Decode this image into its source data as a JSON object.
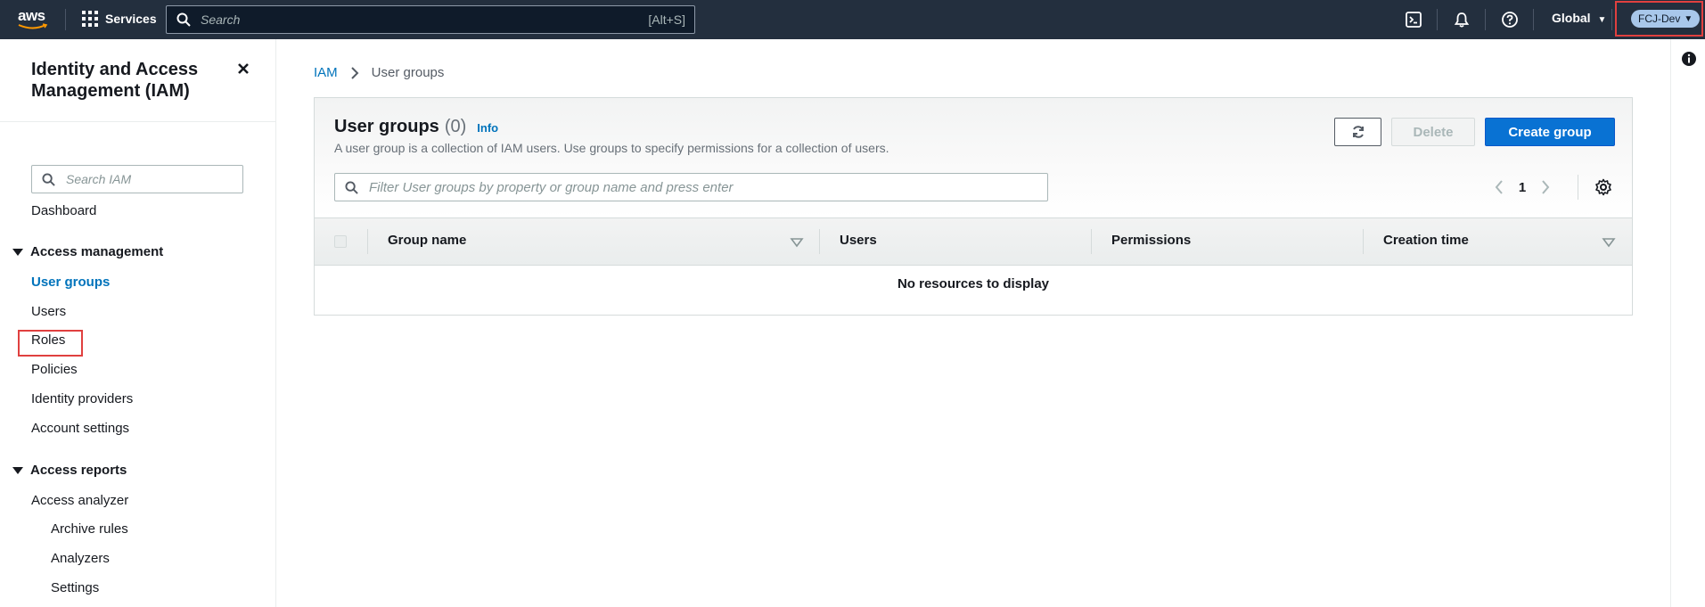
{
  "topnav": {
    "logo": "aws",
    "services_label": "Services",
    "search_placeholder": "Search",
    "search_shortcut": "[Alt+S]",
    "region_label": "Global",
    "account_label": "FCJ-Dev",
    "icons": [
      "cloudshell-icon",
      "bell-icon",
      "help-icon"
    ]
  },
  "sidebar": {
    "title": "Identity and Access Management (IAM)",
    "search_placeholder": "Search IAM",
    "dashboard": "Dashboard",
    "sections": [
      {
        "label": "Access management",
        "items": [
          "User groups",
          "Users",
          "Roles",
          "Policies",
          "Identity providers",
          "Account settings"
        ]
      },
      {
        "label": "Access reports",
        "items": [
          "Access analyzer",
          "Archive rules",
          "Analyzers",
          "Settings"
        ]
      }
    ],
    "active_item": "User groups"
  },
  "breadcrumb": {
    "root": "IAM",
    "current": "User groups"
  },
  "panel": {
    "title": "User groups",
    "count": "(0)",
    "info_link": "Info",
    "description": "A user group is a collection of IAM users. Use groups to specify permissions for a collection of users.",
    "delete_label": "Delete",
    "create_label": "Create group",
    "filter_placeholder": "Filter User groups by property or group name and press enter",
    "page_number": "1",
    "columns": [
      "Group name",
      "Users",
      "Permissions",
      "Creation time"
    ],
    "empty_message": "No resources to display"
  },
  "colors": {
    "nav_bg": "#232f3e",
    "link": "#0073bb",
    "primary_button": "#0972d3",
    "highlight_box": "#e0403f",
    "account_badge": "#a8c7ea"
  }
}
